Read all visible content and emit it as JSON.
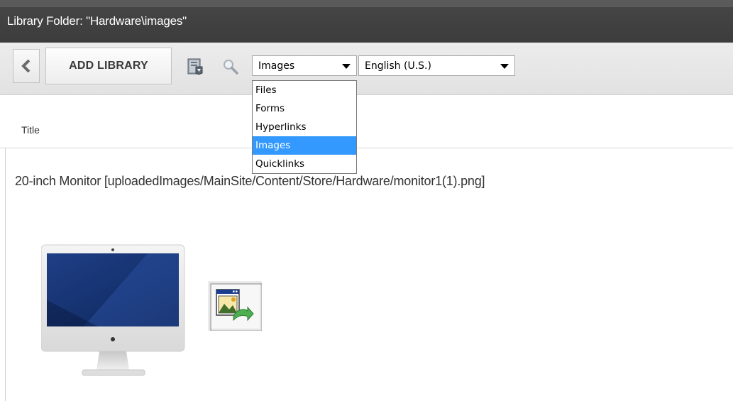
{
  "window": {
    "title": "Library Folder: \"Hardware\\images\""
  },
  "toolbar": {
    "back_icon": "chevron-left-icon",
    "add_library_label": "ADD LIBRARY",
    "library_icon": "library-book-icon",
    "search_icon": "magnifier-icon",
    "type_select": {
      "value": "Images",
      "options": [
        "Files",
        "Forms",
        "Hyperlinks",
        "Images",
        "Quicklinks"
      ],
      "selected_index": 3
    },
    "language_select": {
      "value": "English (U.S.)"
    }
  },
  "list": {
    "column_title": "Title",
    "items": [
      {
        "text": "20-inch Monitor [uploadedImages/MainSite/Content/Store/Hardware/monitor1(1).png]",
        "thumbnail_icon": "monitor-image",
        "action_icon": "insert-image-icon"
      }
    ]
  },
  "colors": {
    "title_bar": "#3c3c3c",
    "toolbar_bg": "#e6e6e6",
    "selection": "#3399ff",
    "text": "#333333"
  }
}
